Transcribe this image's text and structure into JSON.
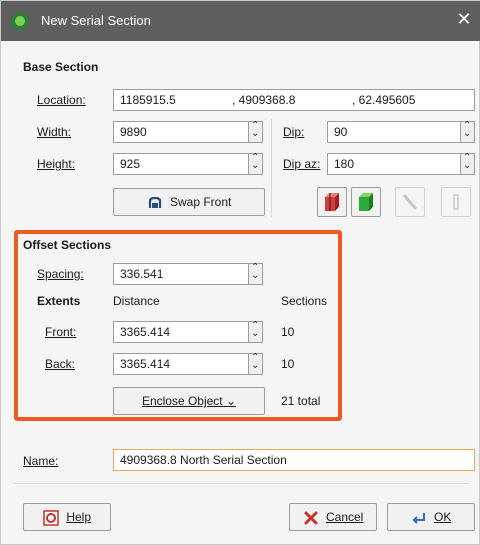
{
  "window": {
    "title": "New Serial Section"
  },
  "base": {
    "heading": "Base Section",
    "location_label": "Location:",
    "location_x": "1185915.5",
    "location_y": ", 4909368.8",
    "location_z": ", 62.495605",
    "width_label": "Width:",
    "width_value": "9890",
    "height_label": "Height:",
    "height_value": "925",
    "dip_label": "Dip:",
    "dip_value": "90",
    "dip_az_label": "Dip az:",
    "dip_az_value": "180",
    "swap_front_label": "Swap Front"
  },
  "offset": {
    "heading": "Offset Sections",
    "spacing_label": "Spacing:",
    "spacing_value": "336.541",
    "extents_label": "Extents",
    "distance_label": "Distance",
    "sections_label": "Sections",
    "front_label": "Front:",
    "front_distance": "3365.414",
    "front_sections": "10",
    "back_label": "Back:",
    "back_distance": "3365.414",
    "back_sections": "10",
    "enclose_label": "Enclose Object ⌄",
    "total_label": "21 total"
  },
  "name": {
    "label": "Name:",
    "value": "4909368.8 North Serial Section"
  },
  "footer": {
    "help_label": "Help",
    "cancel_label": "Cancel",
    "ok_label": "OK"
  },
  "colors": {
    "highlight": "#ee5a24",
    "titlebar": "#5f5f5f"
  },
  "icons": [
    "app-icon",
    "close-icon",
    "swap-front-icon",
    "box-red-icon",
    "box-green-icon",
    "line-icon",
    "pipe-icon",
    "help-icon",
    "cancel-icon",
    "ok-icon"
  ]
}
